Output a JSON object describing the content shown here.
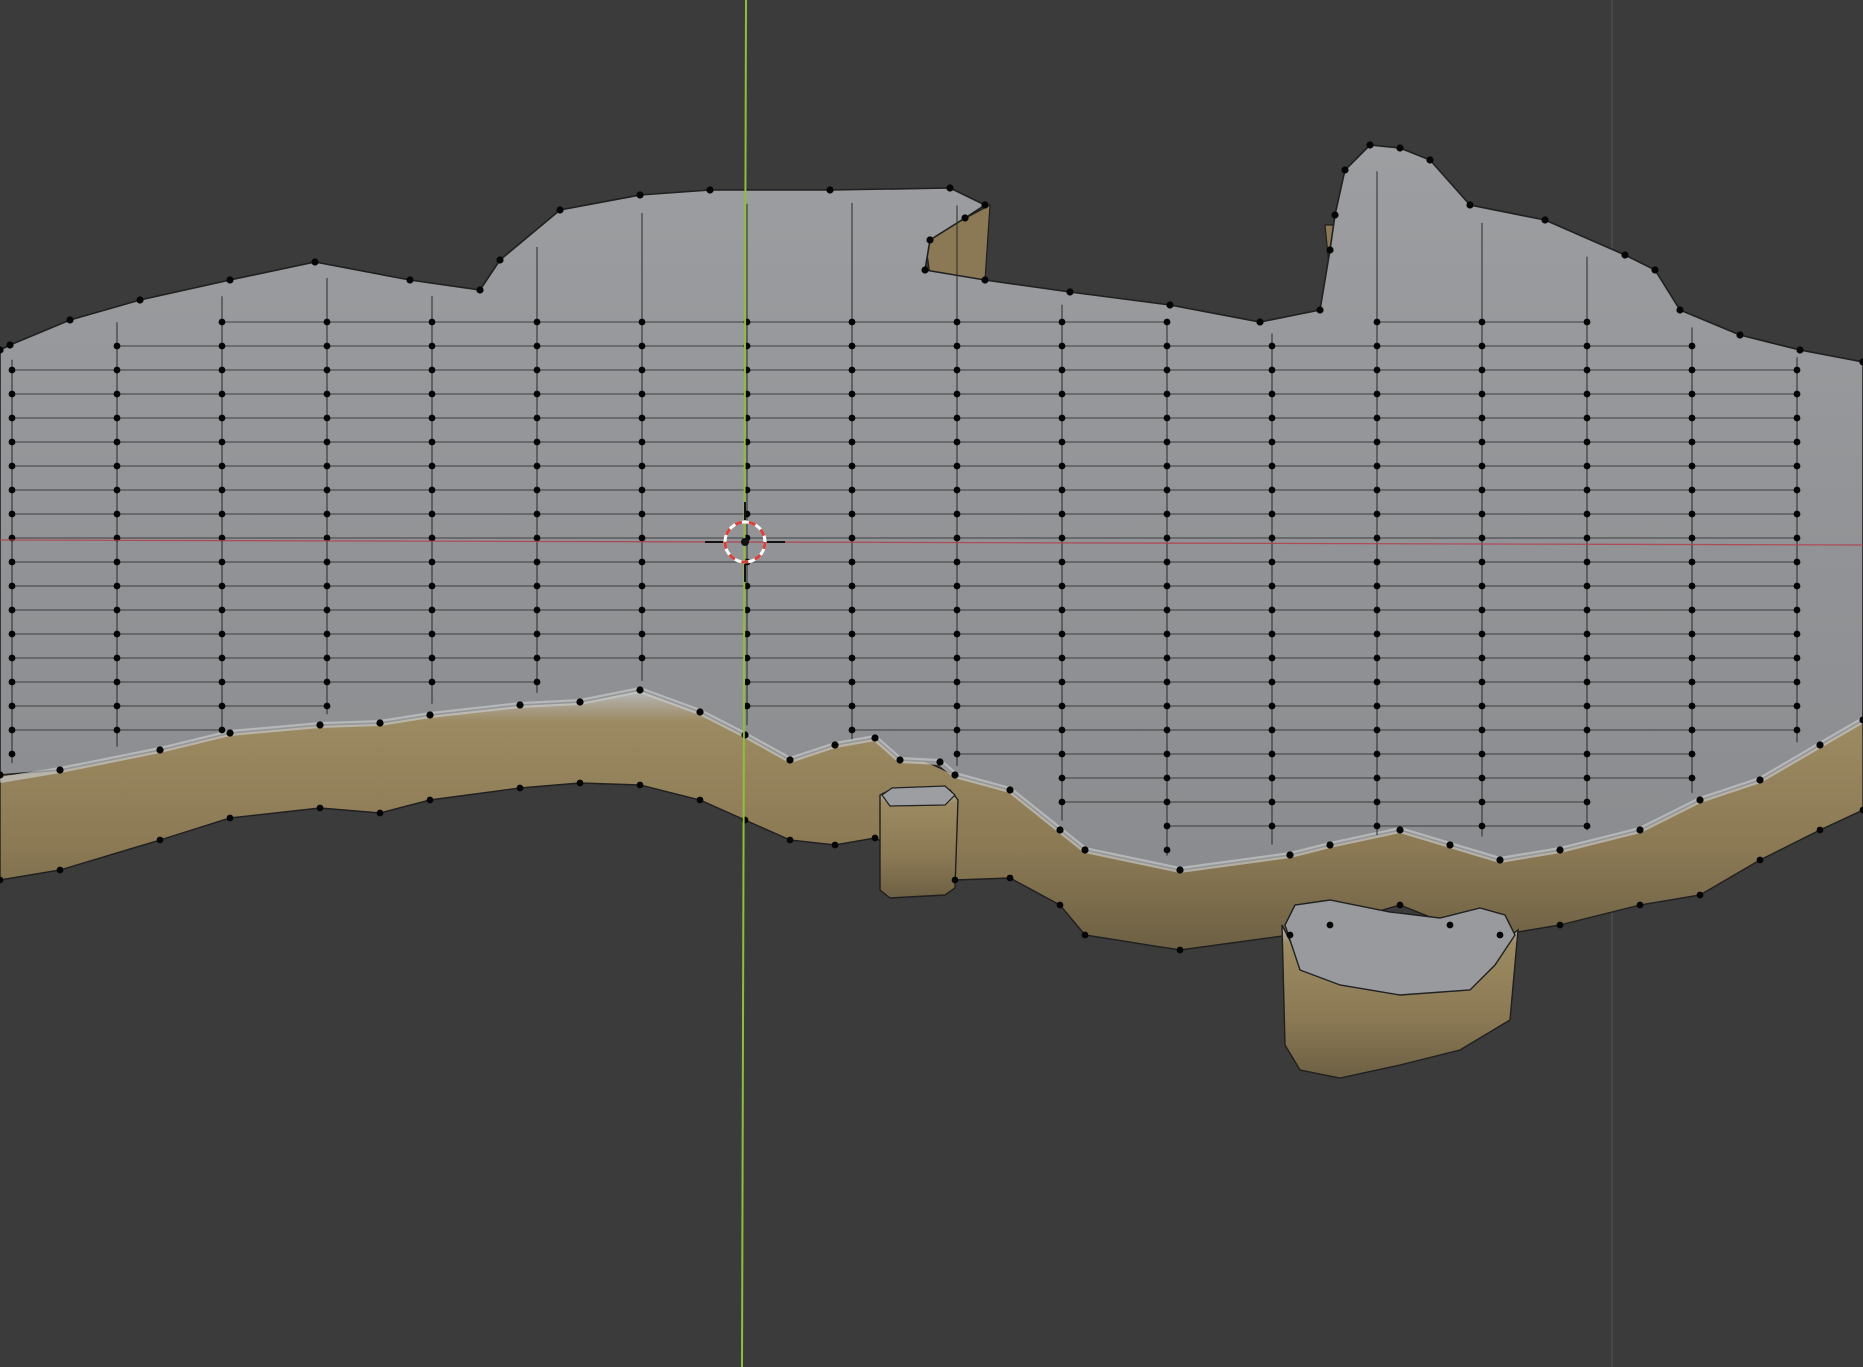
{
  "app": {
    "mode": "edit-mesh",
    "view": "3d-viewport"
  },
  "colors": {
    "background": "#3b3b3b",
    "mesh_top": "#8f9194",
    "mesh_top_light": "#a3a5a8",
    "side_wall": "#8c7a55",
    "side_wall_dark": "#6f6142",
    "edge": "#1c1c1c",
    "vertex": "#050505",
    "axis_x": "#b3404e",
    "axis_y": "#8fbf3a",
    "cursor_red": "#d9403a",
    "cursor_white": "#ffffff"
  },
  "icons": {
    "cursor": "3d-cursor-icon"
  }
}
